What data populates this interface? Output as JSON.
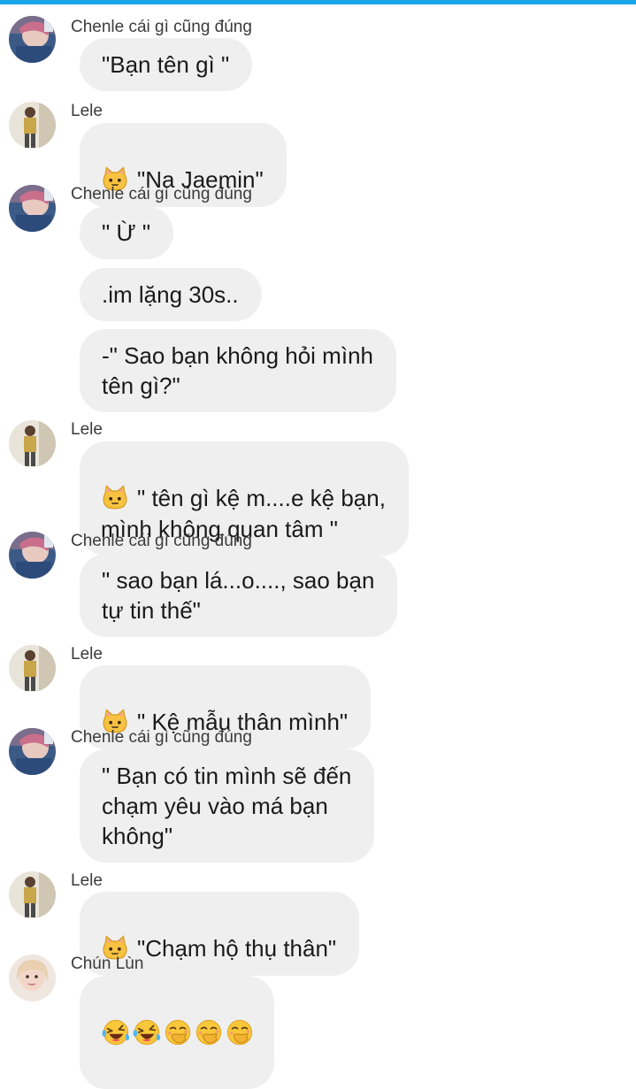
{
  "colors": {
    "accent": "#1aa6e8",
    "bubble": "#efefef"
  },
  "messages": [
    {
      "sender": "Chenle cái gì cũng đúng",
      "avatar": "chenle",
      "bubbles": [
        "\"Bạn tên gì \""
      ]
    },
    {
      "sender": "Lele",
      "avatar": "lele",
      "bubbles": [
        "\"Na Jaemin\""
      ],
      "prefix_icon": "cat-face-icon"
    },
    {
      "sender": "Chenle cái gì cũng đúng",
      "avatar": "chenle",
      "bubbles": [
        "\" Ừ \"",
        ".im lặng 30s..",
        "-\" Sao bạn không hỏi mình\ntên gì?\""
      ]
    },
    {
      "sender": "Lele",
      "avatar": "lele",
      "bubbles": [
        "\" tên gì kệ m....e kệ bạn,\nmình không quan tâm \""
      ],
      "prefix_icon": "cat-face-icon"
    },
    {
      "sender": "Chenle cái gì cũng đúng",
      "avatar": "chenle",
      "bubbles": [
        "\" sao bạn lá...o...., sao bạn\ntự tin thế\""
      ]
    },
    {
      "sender": "Lele",
      "avatar": "lele",
      "bubbles": [
        "\" Kệ mẫu thân mình\""
      ],
      "prefix_icon": "cat-face-icon"
    },
    {
      "sender": "Chenle cái gì cũng đúng",
      "avatar": "chenle",
      "bubbles": [
        "\" Bạn có tin mình sẽ đến\nchạm yêu vào má bạn\nkhông\""
      ]
    },
    {
      "sender": "Lele",
      "avatar": "lele",
      "bubbles": [
        "\"Chạm hộ thụ thân\""
      ],
      "prefix_icon": "cat-face-icon"
    },
    {
      "sender": "Chún Lùn",
      "avatar": "chunlun",
      "emoji_bubble": [
        "laughing-tears-emoji",
        "laughing-tears-emoji",
        "hand-over-mouth-emoji",
        "hand-over-mouth-emoji",
        "hand-over-mouth-emoji"
      ]
    }
  ]
}
